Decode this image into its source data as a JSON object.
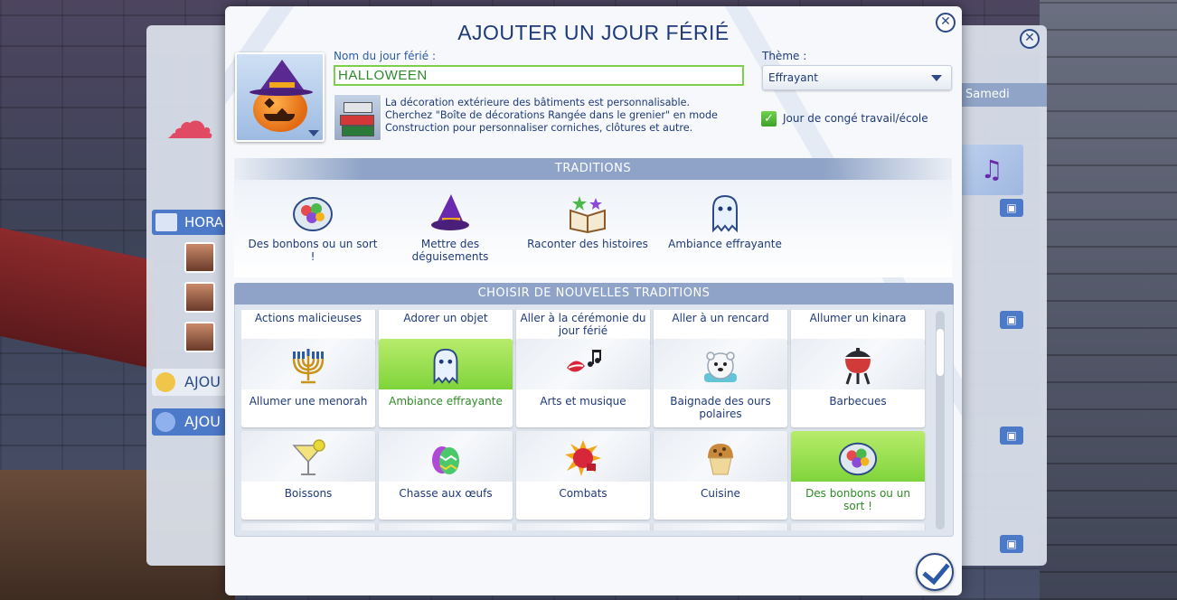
{
  "background": {
    "right_panel_day": "Samedi",
    "left_section_label": "HORA",
    "left_buttons": [
      {
        "label": "AJOU"
      },
      {
        "label": "AJOU"
      }
    ]
  },
  "dialog": {
    "title": "AJOUTER UN JOUR FÉRIÉ",
    "holiday_name_label": "Nom du jour férié :",
    "holiday_name_value": "HALLOWEEN",
    "decoration_text": "La décoration extérieure des bâtiments est personnalisable. Cherchez \"Boîte de décorations Rangée dans le grenier\" en mode Construction pour personnaliser corniches, clôtures et autre.",
    "theme_label": "Thème :",
    "theme_value": "Effrayant",
    "day_off_label": "Jour de congé travail/école",
    "day_off_checked": true,
    "traditions_header": "TRADITIONS",
    "current_traditions": [
      {
        "label": "Des bonbons ou un sort !",
        "icon": "candy-bowl-icon"
      },
      {
        "label": "Mettre des déguisements",
        "icon": "witch-hat-icon"
      },
      {
        "label": "Raconter des histoires",
        "icon": "storybook-icon"
      },
      {
        "label": "Ambiance effrayante",
        "icon": "ghost-icon"
      }
    ],
    "choose_header": "CHOISIR DE NOUVELLES TRADITIONS",
    "partial_row": [
      {
        "label": "Actions malicieuses"
      },
      {
        "label": "Adorer un objet"
      },
      {
        "label": "Aller à la cérémonie du jour férié"
      },
      {
        "label": "Aller à un rencard"
      },
      {
        "label": "Allumer un kinara"
      }
    ],
    "grid_rows": [
      [
        {
          "label": "Allumer une menorah",
          "icon": "menorah-icon",
          "selected": false
        },
        {
          "label": "Ambiance effrayante",
          "icon": "ghost-icon",
          "selected": true
        },
        {
          "label": "Arts et musique",
          "icon": "singing-lips-icon",
          "selected": false
        },
        {
          "label": "Baignade des ours polaires",
          "icon": "polar-bear-icon",
          "selected": false
        },
        {
          "label": "Barbecues",
          "icon": "grill-icon",
          "selected": false
        }
      ],
      [
        {
          "label": "Boissons",
          "icon": "cocktail-icon",
          "selected": false
        },
        {
          "label": "Chasse aux œufs",
          "icon": "easter-egg-icon",
          "selected": false
        },
        {
          "label": "Combats",
          "icon": "boxing-glove-icon",
          "selected": false
        },
        {
          "label": "Cuisine",
          "icon": "muffin-icon",
          "selected": false
        },
        {
          "label": "Des bonbons ou un sort !",
          "icon": "candy-bowl-icon",
          "selected": true
        }
      ]
    ]
  },
  "colors": {
    "title_blue": "#1f3a7a",
    "header_blue": "#8ea3c7",
    "selected_green": "#7fd43a",
    "input_green": "#7ccf4a"
  }
}
